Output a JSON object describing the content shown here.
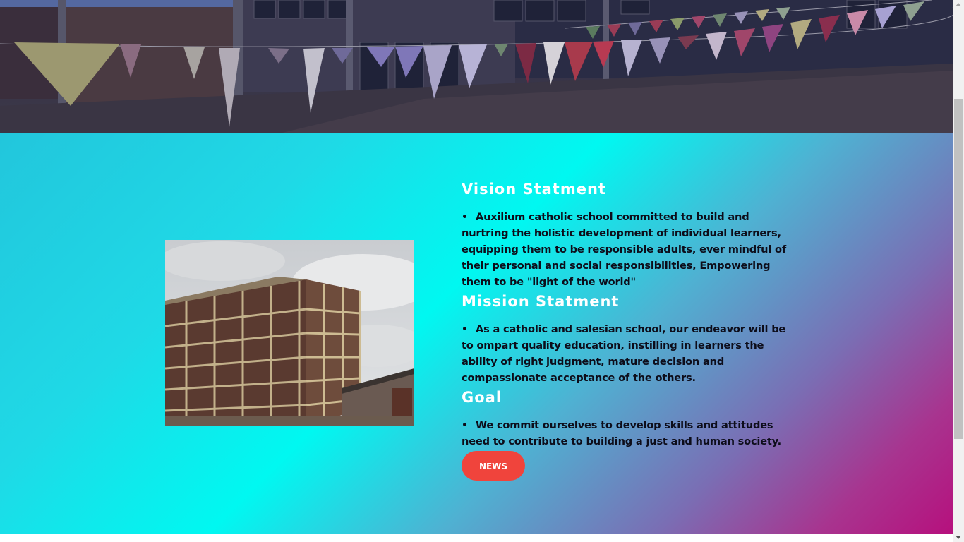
{
  "hero": {
    "image_alt": "school courtyard with festive bunting"
  },
  "school_photo": {
    "image_alt": "school building"
  },
  "sections": [
    {
      "heading": "Vision Statment",
      "bullets": [
        "Auxilium catholic school committed to build and nurtring the holistic development of individual learners, equipping them to be responsible adults, ever mindful of their personal and social responsibilities, Empowering them to be \"light of the world\""
      ]
    },
    {
      "heading": "Mission Statment",
      "bullets": [
        "As a catholic and salesian school, our endeavor will be to ompart quality education, instilling in learners the ability of right judgment, mature decision and compassionate acceptance of the others."
      ]
    },
    {
      "heading": "Goal",
      "bullets": [
        "We commit ourselves to develop skills and attitudes need to contribute to building a just and human society."
      ]
    }
  ],
  "news_button": {
    "label": "NEWS"
  },
  "colors": {
    "gradient_cyan": "#00f8f1",
    "gradient_magenta": "#b6107d",
    "news_button": "#f0443c",
    "heading": "#ffffff",
    "body_text": "#0d0d1a"
  }
}
